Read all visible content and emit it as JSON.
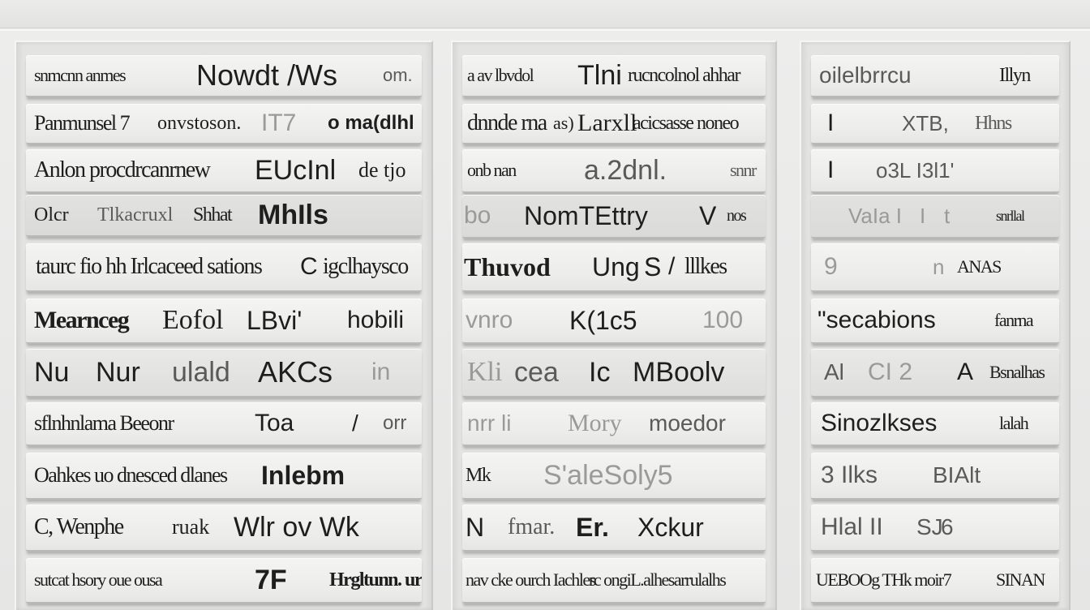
{
  "panels": [
    {
      "rows": [
        {
          "parts": [
            "snmcnn anmes",
            "Nowdt /Ws",
            "om."
          ]
        },
        {
          "parts": [
            "Panmunsel 7",
            "onvstoson.",
            "IT7",
            "o ma(dlhl"
          ]
        },
        {
          "parts": [
            "Anlon procdrcanrnew",
            "EUcInl",
            "de tjo"
          ]
        },
        {
          "parts": [
            "Olcr",
            "Tlkacruxl",
            "Shhat",
            "MhIls"
          ]
        },
        {
          "parts": [
            "taurc fio hh Irlcaceed sations",
            "C",
            "igclhaysco"
          ]
        },
        {
          "parts": [
            "Mearnceg",
            "Eofol",
            "LBvi'",
            "hobili"
          ]
        },
        {
          "parts": [
            "Nu",
            "Nur",
            "ulald",
            "AKCs",
            "in"
          ]
        },
        {
          "parts": [
            "sflnhnlama Beeonr",
            "Toa",
            "/",
            "orr"
          ]
        },
        {
          "parts": [
            "Oahkes uo dnesced dlanes",
            "Inlebm"
          ]
        },
        {
          "parts": [
            "C, Wenphe",
            "ruak",
            "Wlr ov Wk"
          ]
        },
        {
          "parts": [
            "sutcat hsory oue ousa",
            "7F",
            "Hrgltunn. urre"
          ]
        }
      ]
    },
    {
      "rows": [
        {
          "parts": [
            "a av lbvdol",
            "Tlni",
            "rucncolnol ahhar"
          ]
        },
        {
          "parts": [
            "dnnde rna",
            "as)",
            "Larxll",
            "acicsasse noneo"
          ]
        },
        {
          "parts": [
            "onb nan",
            "a.2dnl.",
            "snnr"
          ]
        },
        {
          "parts": [
            "bo",
            "NomTEttry",
            "V",
            "nos"
          ]
        },
        {
          "parts": [
            "Thuvod",
            "Ung",
            "S",
            "/",
            "lllkes"
          ]
        },
        {
          "parts": [
            "vnro",
            "K(1c5",
            "100"
          ]
        },
        {
          "parts": [
            "Kli",
            "cea",
            "Ic",
            "MBoolv"
          ]
        },
        {
          "parts": [
            "nrr li",
            "Mory",
            "moedor"
          ]
        },
        {
          "parts": [
            "Mk",
            "S'aleSoly5"
          ]
        },
        {
          "parts": [
            "N",
            "fmar.",
            "Er.",
            "Xckur"
          ]
        },
        {
          "parts": [
            "nav cke ourch Iachles",
            "rc ongiL.alhesarrulalhs"
          ]
        }
      ]
    },
    {
      "rows": [
        {
          "parts": [
            "oilelbrrcu",
            "Illyn"
          ]
        },
        {
          "parts": [
            "I",
            "XTB,",
            "Hhns"
          ]
        },
        {
          "parts": [
            "I",
            "o3L I3l1'"
          ]
        },
        {
          "parts": [
            "VaIa I",
            "I",
            "t",
            "snrllal"
          ]
        },
        {
          "parts": [
            "9",
            "n",
            "ANAS"
          ]
        },
        {
          "parts": [
            "\"secabions",
            "fanrna"
          ]
        },
        {
          "parts": [
            "Al",
            "CI 2",
            "A",
            "Bsnalhas"
          ]
        },
        {
          "parts": [
            "Sinozlkses",
            "lalah"
          ]
        },
        {
          "parts": [
            "3 Ilks",
            "BIAlt"
          ]
        },
        {
          "parts": [
            "Hlal II",
            "SJ",
            "6"
          ]
        },
        {
          "parts": [
            "UEBOOg THk moir7",
            "SINAN"
          ]
        }
      ]
    }
  ]
}
